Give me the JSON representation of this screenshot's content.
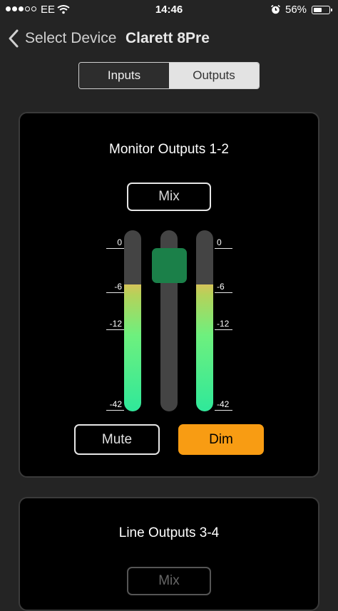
{
  "status_bar": {
    "carrier": "EE",
    "time": "14:46",
    "battery_percent": "56%",
    "battery_level": 0.56,
    "signal_bars_filled": 3,
    "signal_bars_total": 5,
    "icons": [
      "signal-dots-icon",
      "wifi-icon",
      "alarm-clock-icon",
      "battery-icon"
    ]
  },
  "nav": {
    "back_label": "Select Device",
    "device_name": "Clarett 8Pre",
    "back_icon": "chevron-left-icon"
  },
  "segmented": {
    "inputs_label": "Inputs",
    "outputs_label": "Outputs",
    "selected": "Outputs"
  },
  "monitor_card": {
    "title": "Monitor Outputs 1-2",
    "mix_label": "Mix",
    "mute_label": "Mute",
    "dim_label": "Dim",
    "dim_active": true,
    "scale_labels": [
      "0",
      "-6",
      "-12",
      "-42"
    ],
    "meter_left_level": 0.7,
    "meter_right_level": 0.7,
    "fader_position": 0.88,
    "colors": {
      "accent_orange": "#f89c13",
      "fader_green": "#1b8049",
      "meter_top": "#d6c35a",
      "meter_bottom": "#2fe89a"
    }
  },
  "line_card": {
    "title": "Line Outputs 3-4",
    "mix_label": "Mix"
  }
}
